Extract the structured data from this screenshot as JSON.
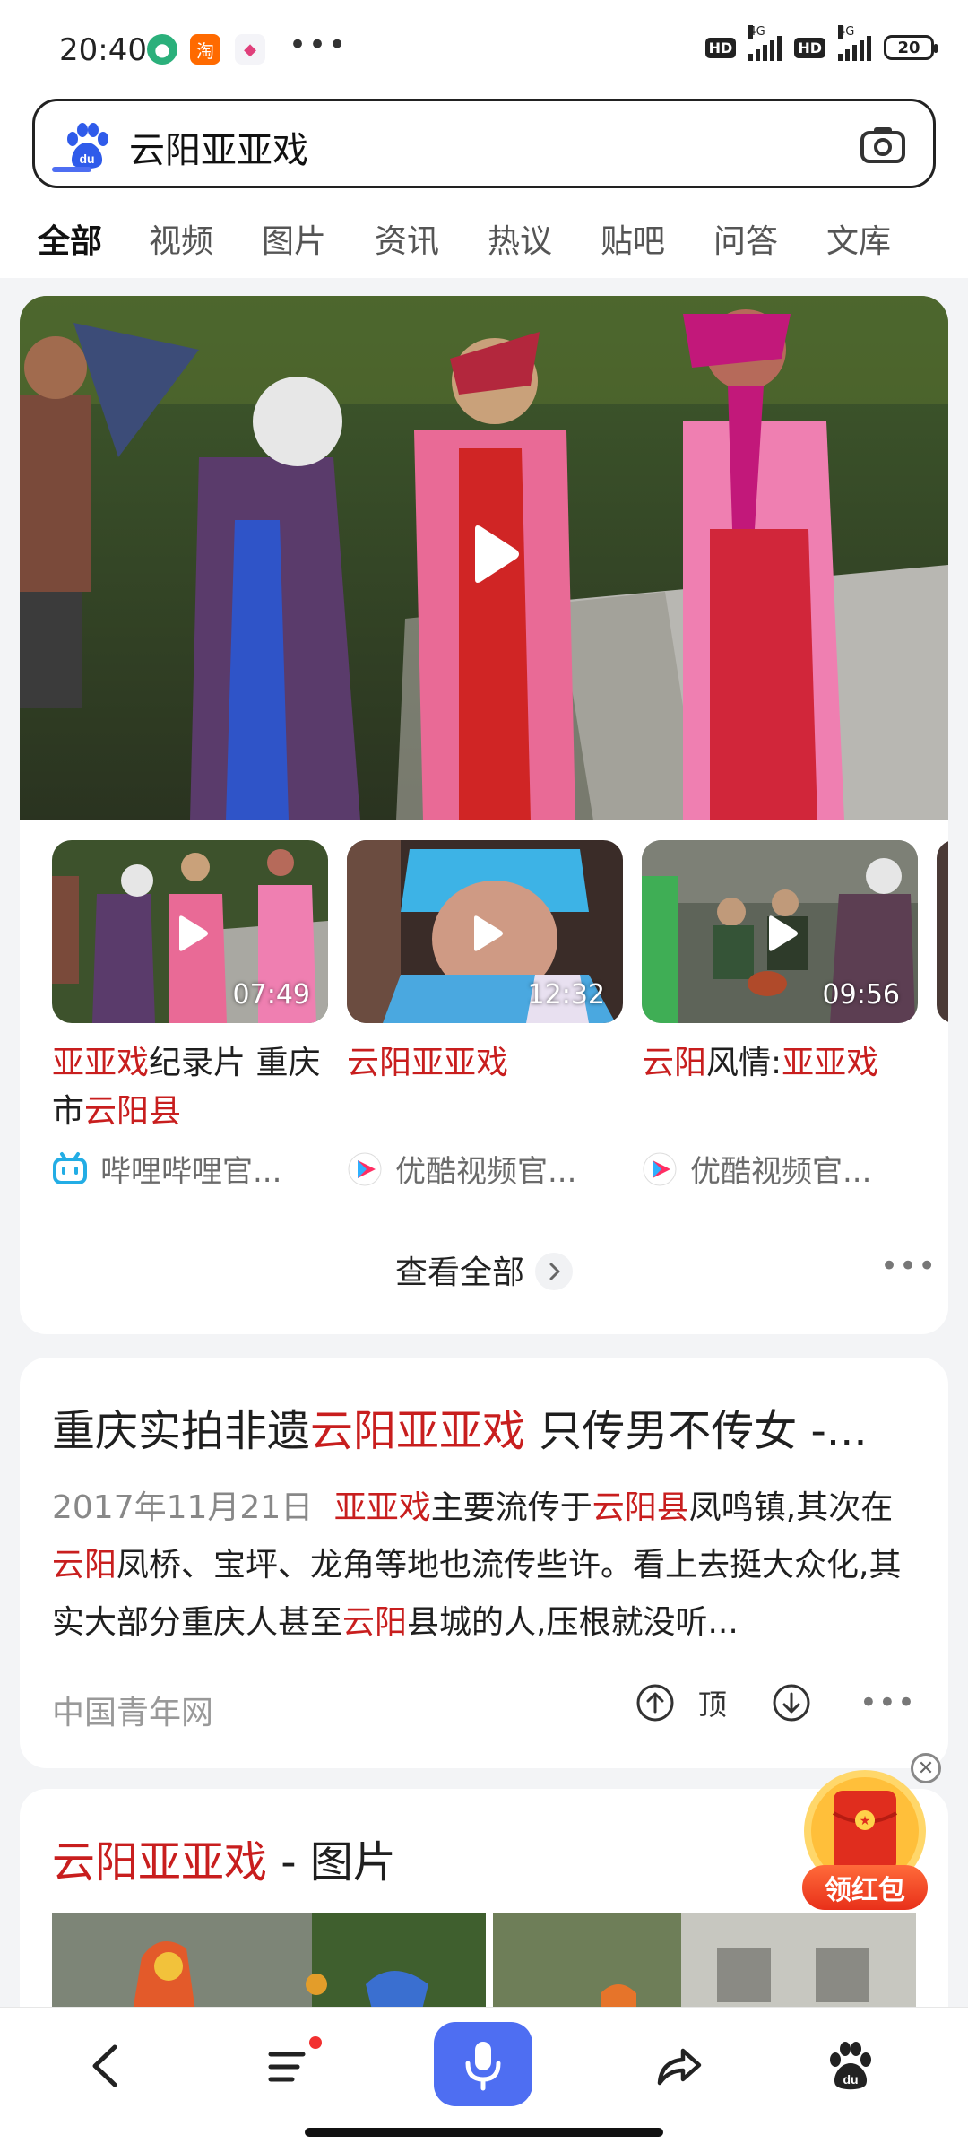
{
  "status_bar": {
    "time": "20:40",
    "battery": "20",
    "network_1": "4G",
    "network_2": "4G",
    "hd": "HD"
  },
  "search": {
    "query": "云阳亚亚戏"
  },
  "tabs": [
    "全部",
    "视频",
    "图片",
    "资讯",
    "热议",
    "贴吧",
    "问答",
    "文库"
  ],
  "video_card": {
    "videos": [
      {
        "duration": "07:49",
        "title_parts": [
          {
            "t": "亚亚戏",
            "hl": true
          },
          {
            "t": "纪录片 重庆市",
            "hl": false
          },
          {
            "t": "云阳县",
            "hl": true
          }
        ],
        "source": "哔哩哔哩官..."
      },
      {
        "duration": "12:32",
        "title_parts": [
          {
            "t": "云阳亚亚戏",
            "hl": true
          }
        ],
        "source": "优酷视频官..."
      },
      {
        "duration": "09:56",
        "title_parts": [
          {
            "t": "云阳",
            "hl": true
          },
          {
            "t": "风情:",
            "hl": false
          },
          {
            "t": "亚亚戏",
            "hl": true
          }
        ],
        "source": "优酷视频官..."
      }
    ],
    "view_all": "查看全部"
  },
  "result": {
    "title_prefix": "重庆实拍非遗",
    "title_hl": "云阳亚亚戏",
    "title_suffix": " 只传男不传女 -...",
    "date": "2017年11月21日",
    "snippet_parts": [
      {
        "t": "亚亚戏",
        "hl": true
      },
      {
        "t": "主要流传于",
        "hl": false
      },
      {
        "t": "云阳县",
        "hl": true
      },
      {
        "t": "凤鸣镇,其次在",
        "hl": false
      },
      {
        "t": "云阳",
        "hl": true
      },
      {
        "t": "凤桥、宝坪、龙角等地也流传些许。看上去挺大众化,其实大部分重庆人甚至",
        "hl": false
      },
      {
        "t": "云阳",
        "hl": true
      },
      {
        "t": "县城的人,压根就没听...",
        "hl": false
      }
    ],
    "source": "中国青年网",
    "upvote_label": "顶"
  },
  "images_card": {
    "title_hl": "云阳亚亚戏",
    "title_suffix": " - 图片"
  },
  "red_packet": {
    "label": "领红包"
  },
  "colors": {
    "accent": "#4e6ef2",
    "highlight": "#c81e1e"
  }
}
